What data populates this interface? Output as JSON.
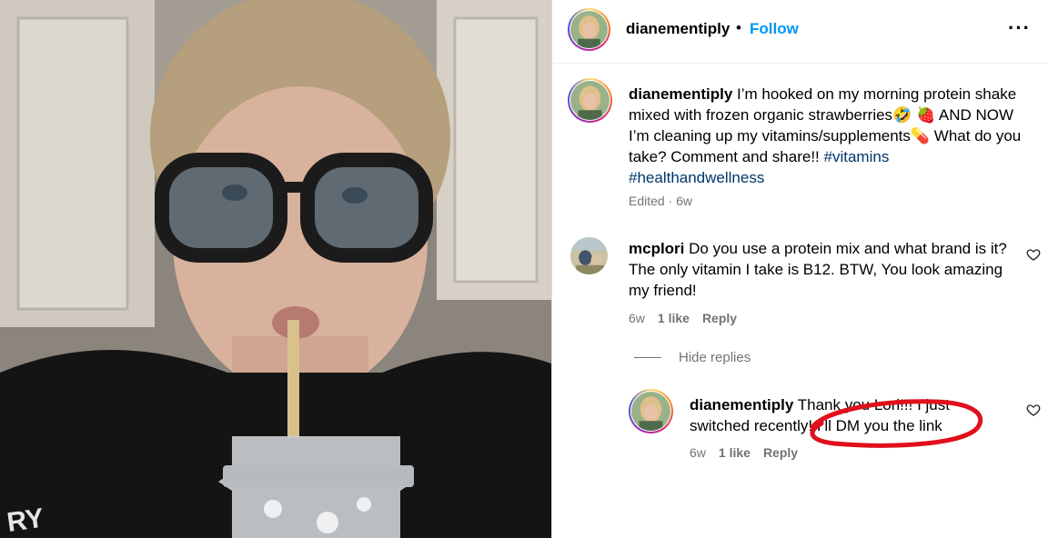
{
  "post": {
    "username": "dianementiply",
    "separator": "•",
    "follow_label": "Follow",
    "more_icon": "more-options-icon"
  },
  "caption": {
    "username": "dianementiply",
    "text_1": "I’m hooked on my morning protein shake mixed with frozen organic strawberries🤣 🍓 AND NOW I’m cleaning up my vitamins/supplements💊 What do you take? Comment and share!! ",
    "tag_1": "#vitamins",
    "tag_2": "#healthandwellness",
    "meta": "Edited · 6w"
  },
  "comment": {
    "username": "mcplori",
    "text": "Do you use a protein mix and what brand is it? The only vitamin I take is B12. BTW, You look amazing my friend!",
    "time": "6w",
    "likes": "1 like",
    "reply_label": "Reply",
    "hide_replies": "Hide replies"
  },
  "reply": {
    "username": "dianementiply",
    "text": "Thank you Lori!!! I just switched recently! I’ll DM you the link",
    "time": "6w",
    "likes": "1 like",
    "reply_label": "Reply"
  },
  "photo": {
    "shirt_text": "RY"
  },
  "colors": {
    "link": "#0095f6",
    "hashtag": "#00376b",
    "secondary": "#737373",
    "annotation": "#e0101c"
  }
}
